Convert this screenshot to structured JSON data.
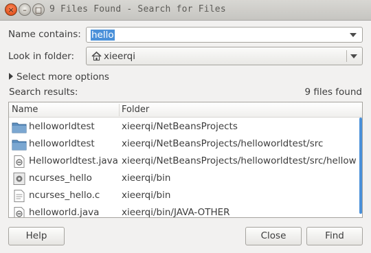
{
  "window": {
    "title": "9 Files Found - Search for Files",
    "controls": {
      "close": "×",
      "minimize": "–",
      "maximize": "□"
    }
  },
  "form": {
    "name_label": "Name contains:",
    "name_value": "hello",
    "folder_label": "Look in folder:",
    "folder_value": "xieerqi",
    "more_options": "Select more options"
  },
  "results": {
    "label": "Search results:",
    "count": "9 files found",
    "col_name": "Name",
    "col_folder": "Folder",
    "rows": [
      {
        "name": "helloworldtest",
        "folder": "xieerqi/NetBeansProjects",
        "icon": "folder-icon"
      },
      {
        "name": "helloworldtest",
        "folder": "xieerqi/NetBeansProjects/helloworldtest/src",
        "icon": "folder-icon"
      },
      {
        "name": "Helloworldtest.java",
        "folder": "xieerqi/NetBeansProjects/helloworldtest/src/hellow",
        "icon": "java-file-icon"
      },
      {
        "name": "ncurses_hello",
        "folder": "xieerqi/bin",
        "icon": "executable-icon"
      },
      {
        "name": "ncurses_hello.c",
        "folder": "xieerqi/bin",
        "icon": "text-file-icon"
      },
      {
        "name": "helloworld.java",
        "folder": "xieerqi/bin/JAVA-OTHER",
        "icon": "java-file-icon"
      }
    ]
  },
  "buttons": {
    "help": "Help",
    "close": "Close",
    "find": "Find"
  },
  "colors": {
    "selection": "#4a90d9",
    "close_button": "#e2531f"
  }
}
